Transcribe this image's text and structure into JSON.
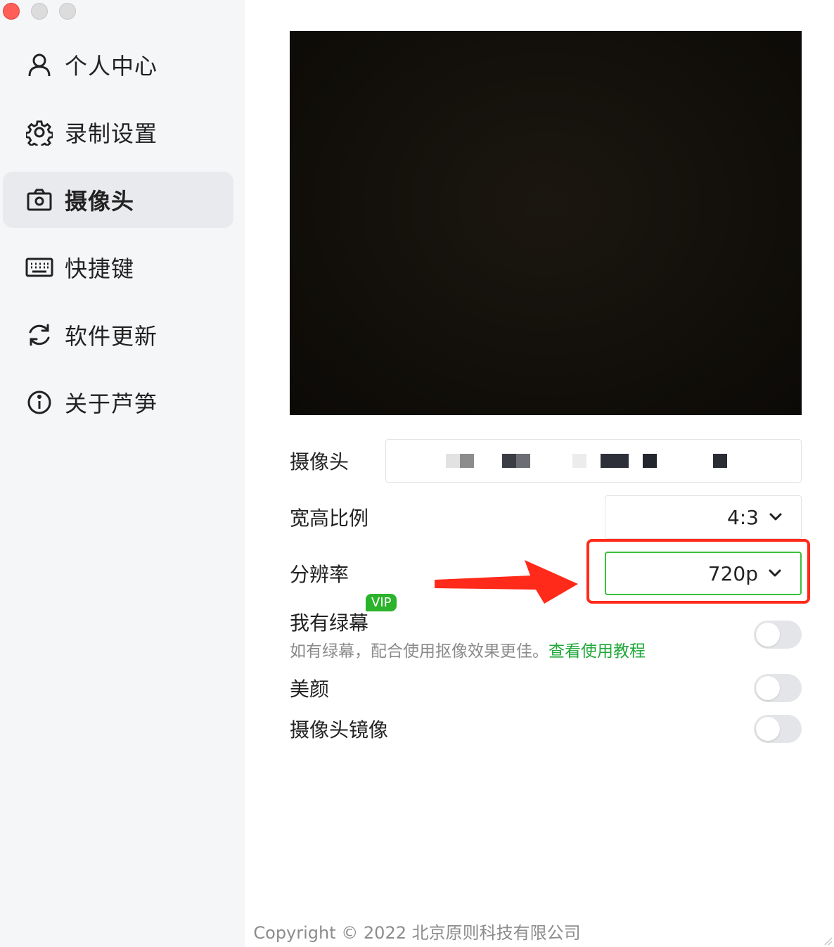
{
  "sidebar": {
    "items": [
      {
        "label": "个人中心",
        "icon": "user-icon"
      },
      {
        "label": "录制设置",
        "icon": "gear-icon"
      },
      {
        "label": "摄像头",
        "icon": "camera-icon",
        "active": true
      },
      {
        "label": "快捷键",
        "icon": "keyboard-icon"
      },
      {
        "label": "软件更新",
        "icon": "refresh-icon"
      },
      {
        "label": "关于芦笋",
        "icon": "info-icon"
      }
    ]
  },
  "settings": {
    "camera_label": "摄像头",
    "aspect_label": "宽高比例",
    "aspect_value": "4:3",
    "resolution_label": "分辨率",
    "resolution_value": "720p",
    "greenscreen_label": "我有绿幕",
    "vip_badge": "VIP",
    "greenscreen_desc": "如有绿幕，配合使用抠像效果更佳。",
    "greenscreen_link": "查看使用教程",
    "beauty_label": "美颜",
    "mirror_label": "摄像头镜像"
  },
  "toggles": {
    "greenscreen": false,
    "beauty": false,
    "mirror": false
  },
  "colors": {
    "accent_green": "#22a83a",
    "vip_green": "#2bb32b",
    "annotation_red": "#ff2a1a"
  },
  "footer": {
    "copyright": "Copyright © 2022 北京原则科技有限公司"
  }
}
